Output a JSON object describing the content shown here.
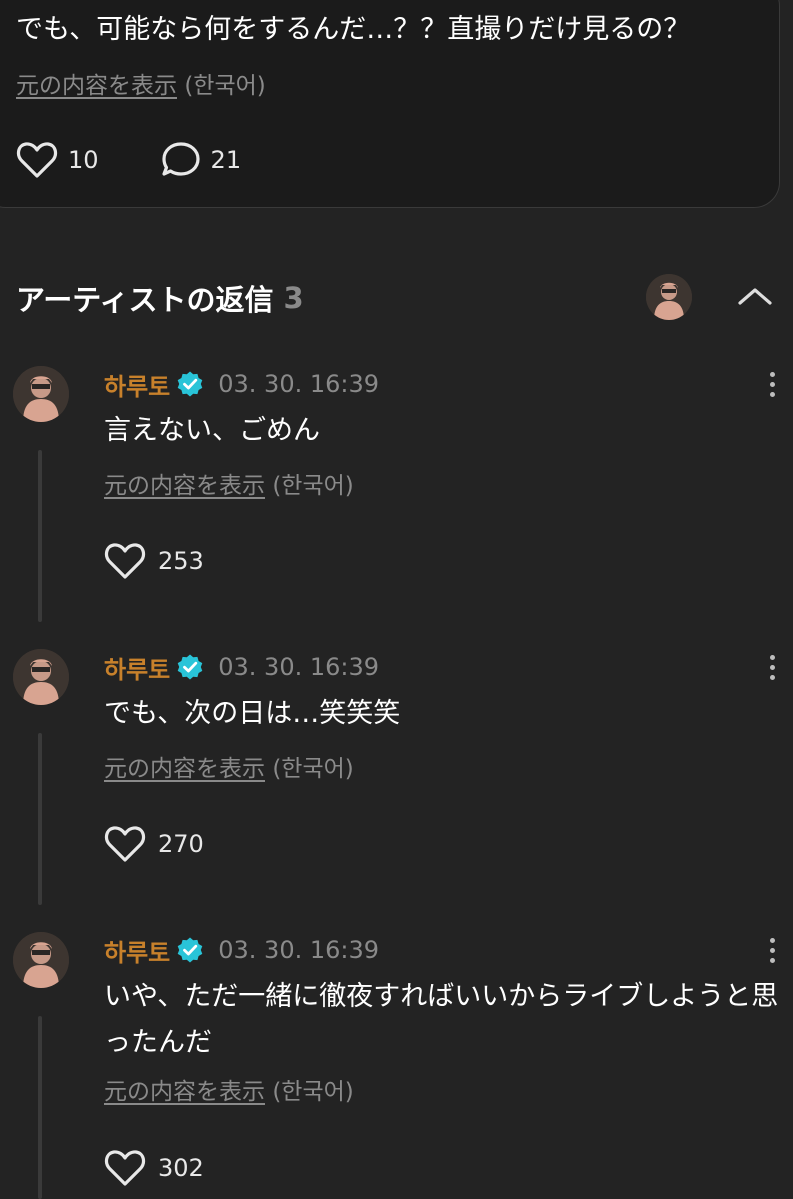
{
  "post": {
    "text": "でも、可能なら何をするんだ…？？直撮りだけ見るの？",
    "translate_link": "元の内容を表示",
    "translate_lang": "(한국어)",
    "likes": "10",
    "comments": "21"
  },
  "artist_replies": {
    "title": "アーティストの返信",
    "count": "3"
  },
  "replies": [
    {
      "author": "하루토",
      "timestamp": "03. 30. 16:39",
      "text": "言えない、ごめん",
      "translate_link": "元の内容を表示",
      "translate_lang": "(한국어)",
      "likes": "253"
    },
    {
      "author": "하루토",
      "timestamp": "03. 30. 16:39",
      "text": "でも、次の日は…笑笑笑",
      "translate_link": "元の内容を表示",
      "translate_lang": "(한국어)",
      "likes": "270"
    },
    {
      "author": "하루토",
      "timestamp": "03. 30. 16:39",
      "text": "いや、ただ一緒に徹夜すればいいからライブしようと思ったんだ",
      "translate_link": "元の内容を表示",
      "translate_lang": "(한국어)",
      "likes": "302"
    }
  ],
  "icons": {
    "like": "heart-outline-icon",
    "comment": "speech-bubble-icon",
    "verified": "verified-badge-icon",
    "more": "vertical-dots-icon",
    "collapse": "chevron-up-icon"
  },
  "colors": {
    "background": "#232323",
    "card": "#1b1b1b",
    "author": "#c8812b",
    "verified": "#29c4d8",
    "muted": "#8a8a8a"
  }
}
